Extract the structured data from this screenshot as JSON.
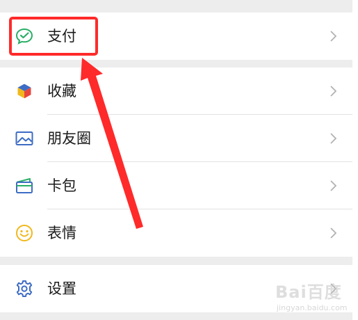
{
  "groups": [
    [
      {
        "id": "pay",
        "label": "支付",
        "icon": "wechat-pay-icon"
      }
    ],
    [
      {
        "id": "favorites",
        "label": "收藏",
        "icon": "cube-icon"
      },
      {
        "id": "moments",
        "label": "朋友圈",
        "icon": "picture-icon"
      },
      {
        "id": "cards",
        "label": "卡包",
        "icon": "wallet-icon"
      },
      {
        "id": "stickers",
        "label": "表情",
        "icon": "smiley-icon"
      }
    ],
    [
      {
        "id": "settings",
        "label": "设置",
        "icon": "gear-icon"
      }
    ]
  ],
  "annotation": {
    "color": "#ff2a2a",
    "target": "pay"
  },
  "watermark": {
    "logo": "Bai百度",
    "url": "jingyan.baidu.com"
  },
  "colors": {
    "background": "#ededed",
    "row": "#ffffff",
    "pay_green": "#2aae67",
    "icon_blue": "#3d6cc4",
    "smiley_yellow": "#f0b81c",
    "chevron": "#b2b2b2"
  }
}
